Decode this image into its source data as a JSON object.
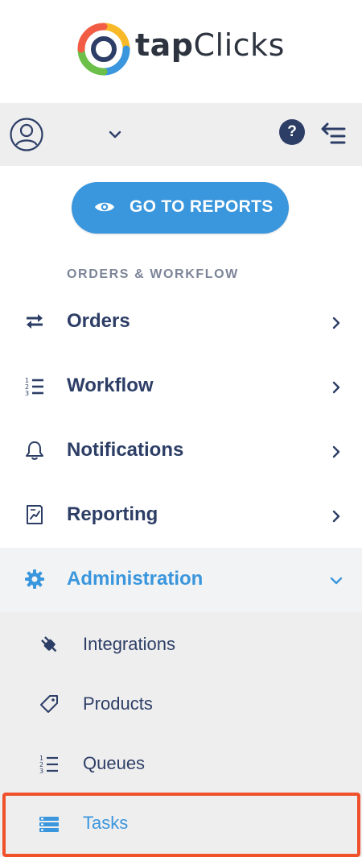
{
  "brand": {
    "name_part1": "tap",
    "name_part2": "Clicks",
    "logo_colors": [
      "#f25c45",
      "#f7b928",
      "#3a96dd",
      "#6cc04a",
      "#2d3e66"
    ]
  },
  "user_bar": {
    "avatar_icon": "user-circle-icon",
    "dropdown_icon": "chevron-down-icon",
    "help_label": "?",
    "collapse_icon": "collapse-sidebar-icon"
  },
  "reports_button": {
    "label": "GO TO REPORTS",
    "icon": "eye-icon"
  },
  "section": {
    "title": "ORDERS & WORKFLOW"
  },
  "nav": {
    "items": [
      {
        "label": "Orders",
        "icon": "arrows-exchange-icon",
        "expanded": false
      },
      {
        "label": "Workflow",
        "icon": "numbered-list-icon",
        "expanded": false
      },
      {
        "label": "Notifications",
        "icon": "bell-icon",
        "expanded": false
      },
      {
        "label": "Reporting",
        "icon": "chart-document-icon",
        "expanded": false
      },
      {
        "label": "Administration",
        "icon": "gear-icon",
        "expanded": true
      }
    ]
  },
  "submenu": {
    "items": [
      {
        "label": "Integrations",
        "icon": "plug-icon"
      },
      {
        "label": "Products",
        "icon": "tag-icon"
      },
      {
        "label": "Queues",
        "icon": "numbered-list-icon"
      },
      {
        "label": "Tasks",
        "icon": "tasks-icon",
        "selected": true
      }
    ]
  },
  "colors": {
    "accent": "#3a96dd",
    "navy": "#2d3e66",
    "highlight": "#f0502a",
    "muted": "#7c8598"
  }
}
